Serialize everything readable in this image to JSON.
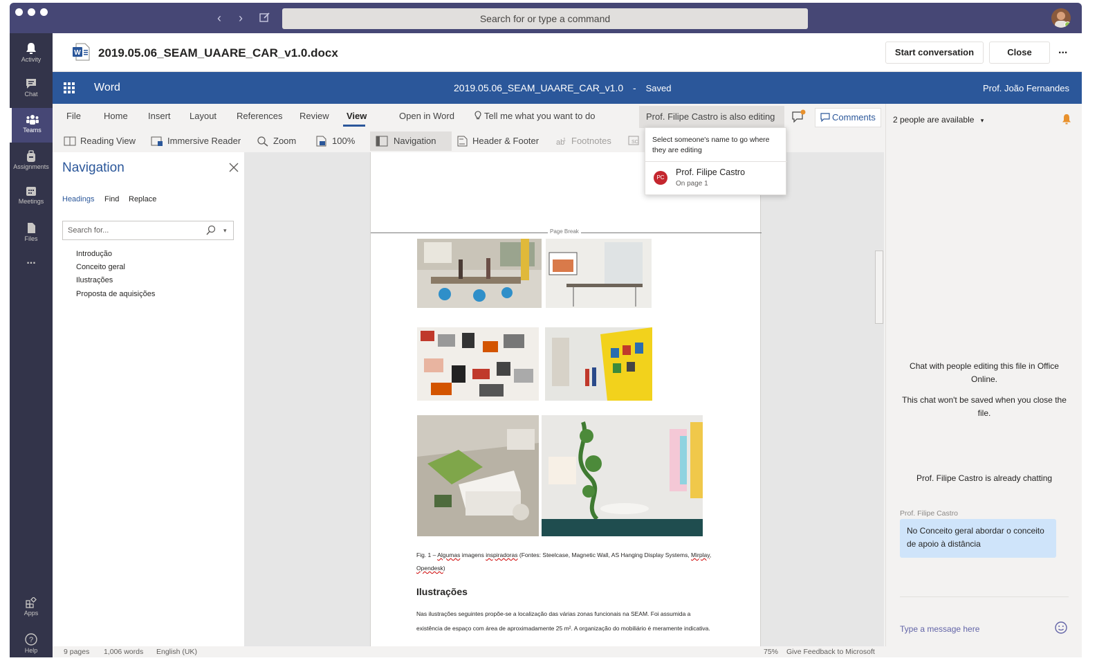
{
  "titlebar": {
    "search_placeholder": "Search for or type a command"
  },
  "rail": {
    "items": [
      {
        "label": "Activity"
      },
      {
        "label": "Chat"
      },
      {
        "label": "Teams"
      },
      {
        "label": "Assignments"
      },
      {
        "label": "Meetings"
      },
      {
        "label": "Files"
      },
      {
        "label": "..."
      },
      {
        "label": "Apps"
      },
      {
        "label": "Help"
      }
    ]
  },
  "file_header": {
    "filename": "2019.05.06_SEAM_UAARE_CAR_v1.0.docx",
    "start_conversation": "Start conversation",
    "close": "Close",
    "more": "..."
  },
  "word_bar": {
    "app_name": "Word",
    "doc_title": "2019.05.06_SEAM_UAARE_CAR_v1.0",
    "separator": "-",
    "save_status": "Saved",
    "user_name": "Prof. João Fernandes"
  },
  "ribbon": {
    "tabs": [
      "File",
      "Home",
      "Insert",
      "Layout",
      "References",
      "Review",
      "View",
      "Open in Word",
      "Tell me what you want to do"
    ],
    "buttons": {
      "reading_view": "Reading View",
      "immersive_reader": "Immersive Reader",
      "zoom": "Zoom",
      "zoom_100": "100%",
      "navigation": "Navigation",
      "header_footer": "Header & Footer",
      "footnotes": "Footnotes"
    },
    "also_editing": "Prof. Filipe Castro is also editing",
    "comments": "Comments"
  },
  "editing_popup": {
    "hint": "Select someone's name to go where they are editing",
    "initials": "PC",
    "name": "Prof. Filipe Castro",
    "location": "On page 1"
  },
  "navigation": {
    "title": "Navigation",
    "tabs": [
      "Headings",
      "Find",
      "Replace"
    ],
    "search_placeholder": "Search for...",
    "headings": [
      "Introdução",
      "Conceito geral",
      "Ilustrações",
      "Proposta de aquisições"
    ]
  },
  "document": {
    "page_break": "Page Break",
    "caption_prefix": "Fig. 1 – ",
    "caption_w1": "Algumas",
    "caption_mid": " imagens ",
    "caption_w2": "inspiradoras",
    "caption_rest": " (Fontes: Steelcase, Magnetic Wall, AS Hanging Display Systems, ",
    "caption_w3": "Mirplay",
    "caption_comma": ", ",
    "caption_w4": "Opendesk",
    "caption_end": ")",
    "heading": "Ilustrações",
    "paragraph": "Nas ilustrações seguintes propõe-se a localização das várias zonas funcionais na SEAM. Foi assumida a existência de espaço com área de aproximadamente 25 m². A organização do mobiliário é meramente indicativa."
  },
  "chat": {
    "availability": "2 people are available",
    "note1": "Chat with people editing this file in Office Online.",
    "note2": "This chat won't be saved when you close the file.",
    "already_chatting": "Prof. Filipe Castro is already chatting",
    "message_sender": "Prof. Filipe Castro",
    "message_text": "No Conceito geral abordar o conceito de apoio à distância",
    "input_placeholder": "Type a message here"
  },
  "statusbar": {
    "pages": "9 pages",
    "words": "1,006 words",
    "language": "English (UK)",
    "zoom": "75%",
    "feedback": "Give Feedback to Microsoft"
  },
  "colors": {
    "teams_purple": "#464775",
    "rail_dark": "#33344a",
    "word_blue": "#2b579a",
    "chat_bubble": "#cfe4fa",
    "presence_red": "#c4262e"
  }
}
